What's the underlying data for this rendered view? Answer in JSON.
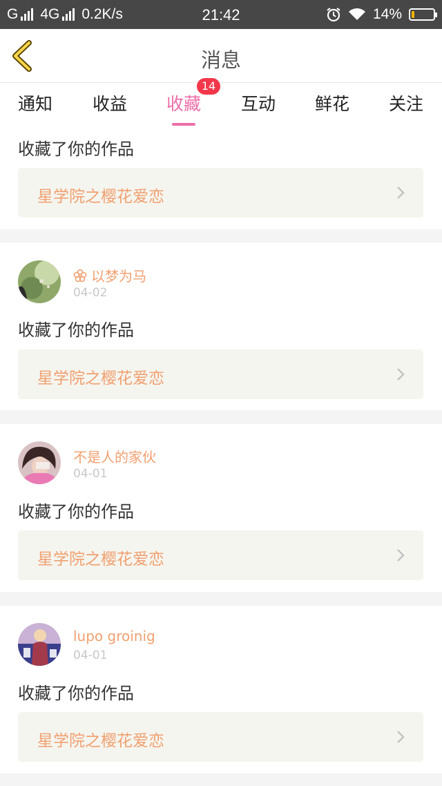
{
  "status_bar": {
    "carrier1": "G",
    "carrier2": "4G",
    "speed": "0.2K/s",
    "time": "21:42",
    "battery_text": "14%",
    "battery_level": 0.14,
    "icons": [
      "signal-bars-icon",
      "alarm-icon",
      "wifi-icon",
      "battery-icon"
    ]
  },
  "header": {
    "title": "消息",
    "back_icon": "chevron-left-icon"
  },
  "tabs": {
    "items": [
      {
        "label": "通知"
      },
      {
        "label": "收益"
      },
      {
        "label": "收藏"
      },
      {
        "label": "互动"
      },
      {
        "label": "鲜花"
      },
      {
        "label": "关注"
      }
    ],
    "active_index": 2,
    "badge": "14"
  },
  "colors": {
    "accent_pink": "#ec6ea8",
    "orange_text": "#f0a070",
    "badge_red": "#f2374b",
    "status_bar_bg": "#474747"
  },
  "notifications": [
    {
      "user": "",
      "date": "",
      "action": "收藏了你的作品",
      "work_title": "星学院之樱花爱恋"
    },
    {
      "user": "以梦为马",
      "user_prefix_icon": "flower-icon",
      "date": "04-02",
      "action": "收藏了你的作品",
      "work_title": "星学院之樱花爱恋"
    },
    {
      "user": "不是人的家伙",
      "date": "04-01",
      "action": "收藏了你的作品",
      "work_title": "星学院之樱花爱恋"
    },
    {
      "user": "lupo groinig",
      "date": "04-01",
      "action": "收藏了你的作品",
      "work_title": "星学院之樱花爱恋"
    }
  ]
}
